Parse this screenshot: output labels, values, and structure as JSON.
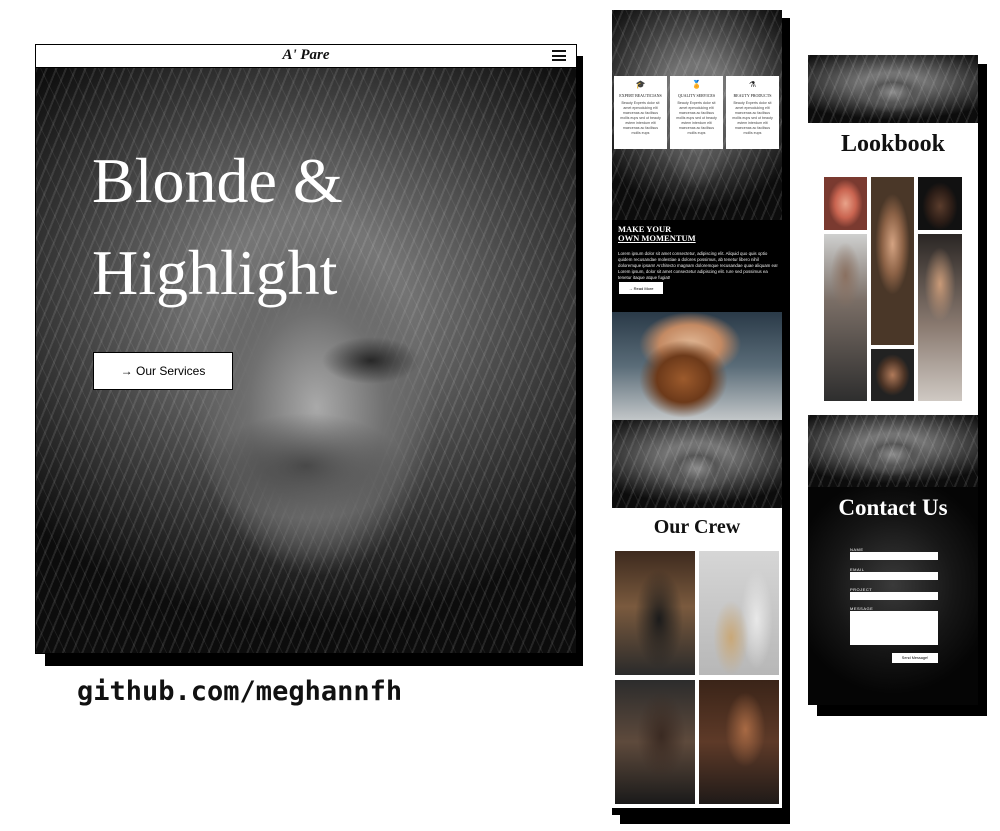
{
  "desktop": {
    "brand": "A' Pare",
    "menu_icon": "hamburger-icon",
    "hero_title": "Blonde & Highlight",
    "cta_label": "→ Our Services"
  },
  "credit": "github.com/meghannfh",
  "mobile1": {
    "features": [
      {
        "icon": "graduation-cap-icon",
        "title": "EXPERT BEAUTICIANS",
        "body": "Beauty Experts dolor sit amet epmoduking elit maecenas ac facilisus mollis eups sed ut beauty estem interdum elit maecenas ac facilisus mollis eups"
      },
      {
        "icon": "award-icon",
        "title": "QUALITY SERVICES",
        "body": "Beauty Experts dolor sit amet epmoduking elit maecenas ac facilisus mollis eups sed ut beauty estem interdum elit maecenas ac facilisus mollis eups"
      },
      {
        "icon": "flask-icon",
        "title": "BEAUTY PRODUCTS",
        "body": "Beauty Experts dolor sit amet epmoduking elit maecenas ac facilisus mollis eups sed ut beauty estem interdum elit maecenas ac facilisus mollis eups"
      }
    ],
    "momentum_line1": "MAKE YOUR",
    "momentum_line2": "OWN MOMENTUM",
    "momentum_body": "Lorem ipsum dolor sit amet consectetur, adipiscing elit. Aliquid quo quis optio quidem recusandae molestiae a dolores possimus, ab tenetur libero nihil doloremque ipsam! Architecto magnam doloremque recusandae quae aliquam ea! Lorem ipsum, dolor sit amet consectetur adipiscing elit. Iure sed possimus ea tenetur itaque atque fugiat!",
    "read_more": "→ Read More",
    "crew_title": "Our Crew"
  },
  "mobile2": {
    "lookbook_title": "Lookbook",
    "contact_title": "Contact Us",
    "labels": [
      "NAME",
      "EMAIL",
      "PROJECT",
      "MESSAGE"
    ],
    "send_label": "Send Message!"
  }
}
